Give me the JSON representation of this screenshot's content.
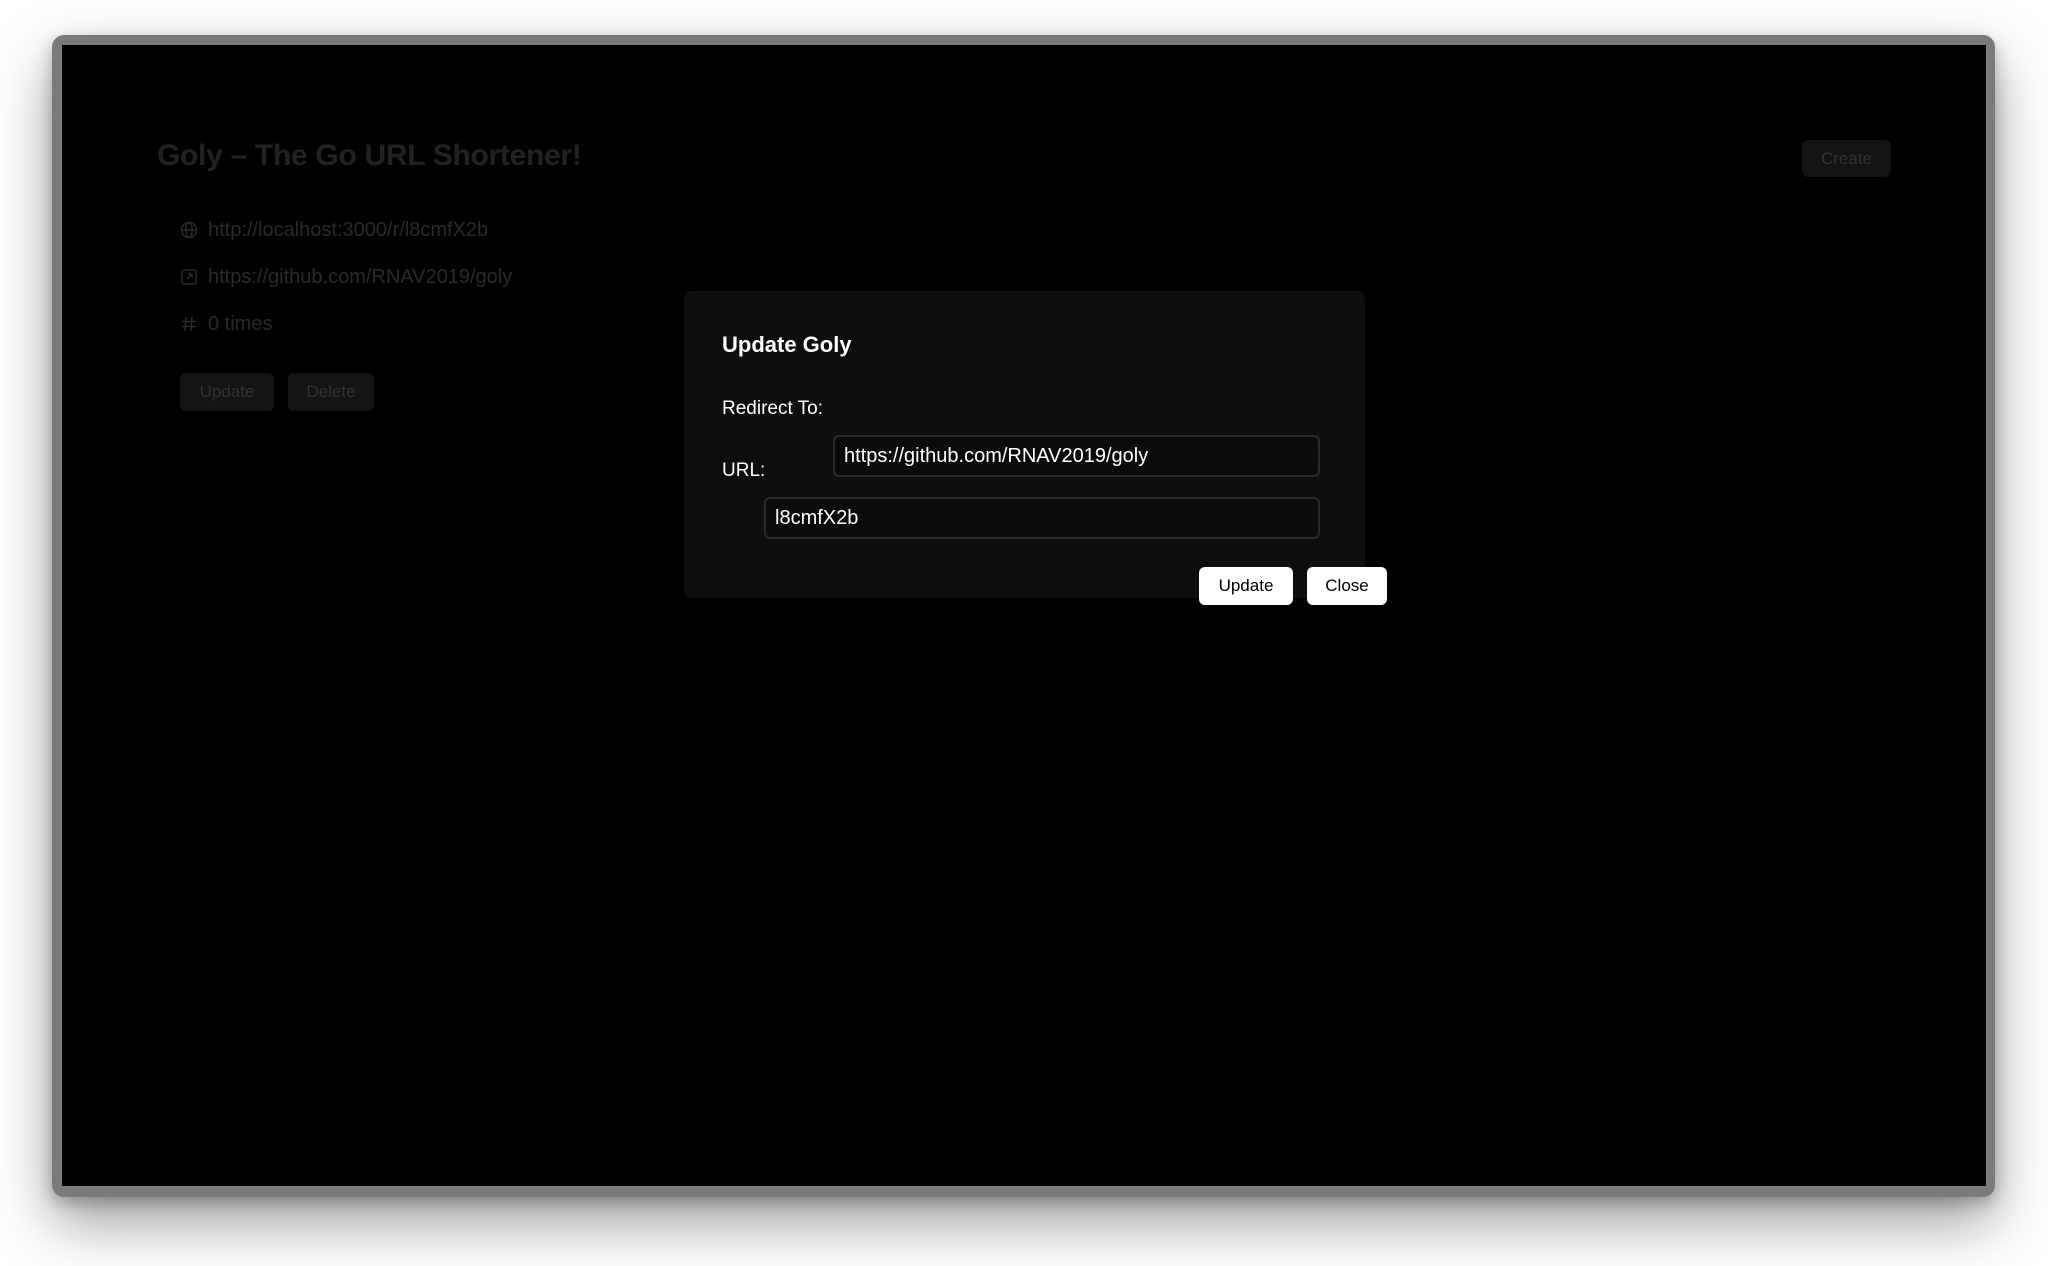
{
  "page": {
    "title": "Goly – The Go URL Shortener!",
    "create_label": "Create"
  },
  "goly_card": {
    "short_url": "http://localhost:3000/r/l8cmfX2b",
    "redirect": "https://github.com/RNAV2019/goly",
    "clicks": "0 times",
    "update_label": "Update",
    "delete_label": "Delete",
    "icons": [
      "globe-icon",
      "external-link-icon",
      "hash-icon"
    ]
  },
  "modal": {
    "title": "Update Goly",
    "redirect_label": "Redirect To:",
    "redirect_value": "https://github.com/RNAV2019/goly",
    "url_label": "URL:",
    "url_value": "l8cmfX2b",
    "update_label": "Update",
    "close_label": "Close"
  },
  "colors": {
    "overlay": "#000000",
    "modal_bg": "#0e0e0e",
    "modal_button_bg": "#ffffff",
    "frame": "#7a7a7a"
  }
}
